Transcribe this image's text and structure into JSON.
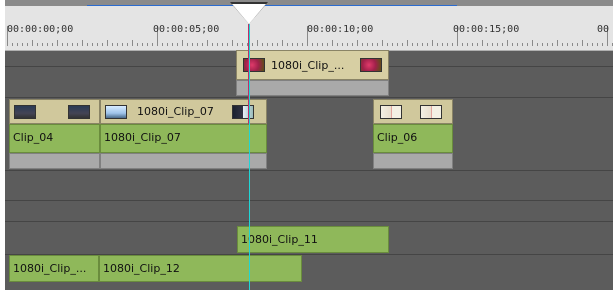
{
  "ruler": {
    "labels": [
      "00:00:00;00",
      "00:00:05;00",
      "00:00:10;00",
      "00:00:15;00",
      "00"
    ]
  },
  "tracks": {
    "track_1": {
      "clip_a": {
        "label": "1080i_Clip_..."
      }
    },
    "track_2": {
      "clip_04": {
        "label": "Clip_04"
      },
      "clip_07": {
        "title": "1080i_Clip_07",
        "label": "1080i_Clip_07"
      },
      "clip_06": {
        "label": "Clip_06"
      }
    },
    "track_4": {
      "clip_11": {
        "label": "1080i_Clip_11"
      },
      "clip_trunc": {
        "label": "1080i_Clip_..."
      },
      "clip_12": {
        "label": "1080i_Clip_12"
      }
    }
  },
  "colors": {
    "background": "#5c5c5c",
    "clip_green": "#8fb85a",
    "clip_thumb_bg": "#d0c89c",
    "clip_gray": "#a9a9a9",
    "playhead_cyan": "#1fd6d6",
    "playhead_red": "#c0306a",
    "progress_blue": "#2a6bd0"
  }
}
